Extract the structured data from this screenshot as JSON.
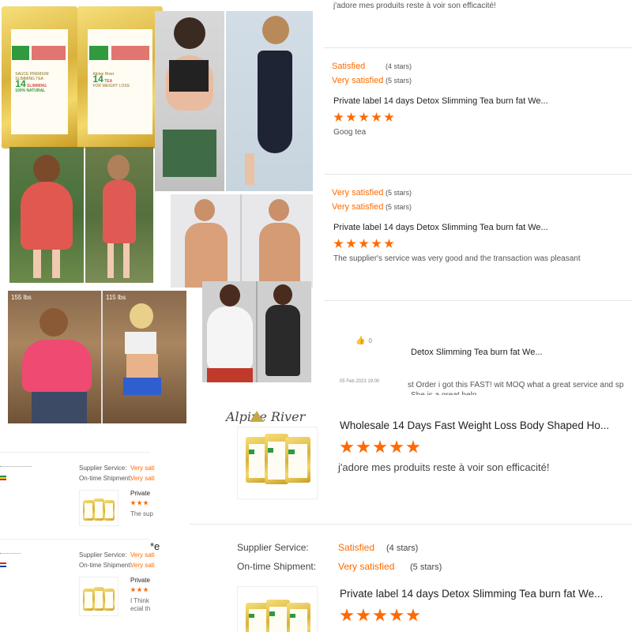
{
  "reviews_top": {
    "r1_comment": "j'adore mes produits reste à voir son efficacité!",
    "r2": {
      "supplier_level": "Satisfied",
      "supplier_count": "(4 stars)",
      "shipment_level": "Very satisfied",
      "shipment_count": "(5 stars)",
      "title": "Private label 14 days Detox Slimming Tea burn fat We...",
      "comment": "Goog tea"
    },
    "r3": {
      "supplier_level": "Very satisfied",
      "supplier_count": "(5 stars)",
      "shipment_level": "Very satisfied",
      "shipment_count": "(5 stars)",
      "title": "Private label 14 days Detox Slimming Tea burn fat We...",
      "comment": "The supplier's service was very good and the transaction was pleasant"
    },
    "r4": {
      "likes": "0",
      "date": "05 Feb 2023 19:00",
      "title": "Detox Slimming Tea burn fat We...",
      "comment_line1": "st Order i got this FAST! wit MOQ what a great service and sp",
      "comment_line2": "She is a great help."
    }
  },
  "main_review": {
    "logo_text": "Alpine River",
    "title": "Wholesale 14 Days Fast Weight Loss Body Shaped Ho...",
    "comment": "j'adore mes produits reste à voir son efficacité!"
  },
  "bottom_review": {
    "star_char": "*e",
    "supplier_label": "Supplier Service:",
    "supplier_level": "Satisfied",
    "supplier_count": "(4 stars)",
    "shipment_label": "On-time Shipment:",
    "shipment_level": "Very satisfied",
    "shipment_count": "(5 stars)",
    "title": "Private label 14 days Detox Slimming Tea burn fat We..."
  },
  "left_small": {
    "row1": {
      "supplier_label": "Supplier Service:",
      "supplier_level": "Very sati",
      "shipment_label": "On-time Shipment:",
      "shipment_level": "Very sati",
      "title": "Private",
      "comment": "The sup"
    },
    "row2": {
      "supplier_label": "Supplier Service:",
      "supplier_level": "Very sati",
      "shipment_label": "On-time Shipment:",
      "shipment_level": "Very sati",
      "title": "Private",
      "comment1": "I Think",
      "comment2": "ecial th"
    }
  },
  "package": {
    "brand": "Alpine River",
    "tagline": "SAUCE PREMIUM SLIMMING TEA",
    "days": "14",
    "name_line1": "DAY",
    "name_line2": "SLIMMING",
    "name_line3": "TEA",
    "natural": "100% NATURAL",
    "sub": "FOR WEIGHT LOSS",
    "ingredients": [
      "GINSENG",
      "GREEN TEA",
      "HSW",
      "WINTER MELON",
      "JUJUBE",
      "CASSIA SEED",
      "RADISH",
      "ORANGE PEEL",
      "CASSIA"
    ]
  },
  "photo_labels": {
    "before": "155 lbs",
    "after": "115 lbs"
  },
  "colors": {
    "accent": "#ff6a00",
    "text": "#333333",
    "divider": "#e6e6e6"
  }
}
